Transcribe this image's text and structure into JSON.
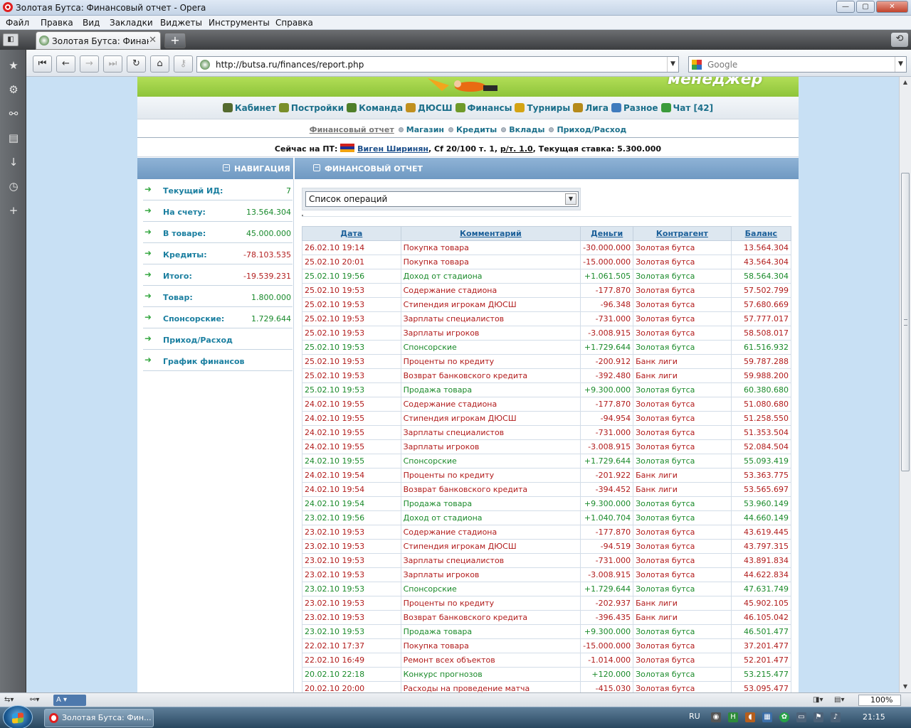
{
  "window": {
    "title": "Золотая Бутса: Финансовый отчет - Opera",
    "min": "—",
    "max": "▢",
    "close": "✕"
  },
  "menu": [
    "Файл",
    "Правка",
    "Вид",
    "Закладки",
    "Виджеты",
    "Инструменты",
    "Справка"
  ],
  "tab": {
    "title": "Золотая Бутса: Финан...",
    "close": "✕",
    "new": "+"
  },
  "address": {
    "url": "http://butsa.ru/finances/report.php",
    "search_placeholder": "Google"
  },
  "site": {
    "logo": "менеджер",
    "nav": [
      {
        "label": "Кабинет",
        "icon": "pencil-icon",
        "color": "#556b2f"
      },
      {
        "label": "Постройки",
        "icon": "buildings-icon",
        "color": "#7a8f2a"
      },
      {
        "label": "Команда",
        "icon": "player-icon",
        "color": "#4f7f2a"
      },
      {
        "label": "ДЮСШ",
        "icon": "kid-icon",
        "color": "#c09020"
      },
      {
        "label": "Финансы",
        "icon": "money-icon",
        "color": "#6f9a2a"
      },
      {
        "label": "Турниры",
        "icon": "trophy-icon",
        "color": "#d4a414"
      },
      {
        "label": "Лига",
        "icon": "league-icon",
        "color": "#b58a1a"
      },
      {
        "label": "Разное",
        "icon": "chart-icon",
        "color": "#3f7bbd"
      },
      {
        "label": "Чат [42]",
        "icon": "chat-icon",
        "color": "#3b9b3b"
      }
    ],
    "subnav": [
      "Финансовый отчет",
      "Магазин",
      "Кредиты",
      "Вклады",
      "Приход/Расход"
    ],
    "status": {
      "prefix": "Сейчас на ПТ:",
      "user": "Виген Ширинян",
      "mid1": ", Cf 20/100 т. 1,",
      "rate_link": "р/т. 1.0",
      "suffix": ", Текущая ставка: 5.300.000"
    },
    "nav_header": "НАВИГАЦИЯ",
    "report_header": "ФИНАНСОВЫЙ ОТЧЕТ",
    "left_items": [
      {
        "label": "Текущий ИД:",
        "value": "7",
        "tone": "g"
      },
      {
        "label": "На счету:",
        "value": "13.564.304",
        "tone": "g"
      },
      {
        "label": "В товаре:",
        "value": "45.000.000",
        "tone": "g"
      },
      {
        "label": "Кредиты:",
        "value": "-78.103.535",
        "tone": "r"
      },
      {
        "label": "Итого:",
        "value": "-19.539.231",
        "tone": "r"
      },
      {
        "label": "Товар:",
        "value": "1.800.000",
        "tone": "g"
      },
      {
        "label": "Спонсорские:",
        "value": "1.729.644",
        "tone": "g"
      },
      {
        "label": "Приход/Расход",
        "value": "",
        "tone": "g"
      },
      {
        "label": "График финансов",
        "value": "",
        "tone": "g"
      }
    ],
    "select_value": "Список операций",
    "columns": [
      "Дата",
      "Комментарий",
      "Деньги",
      "Контрагент",
      "Баланс"
    ],
    "rows": [
      [
        "26.02.10 19:14",
        "Покупка товара",
        "-30.000.000",
        "Золотая бутса",
        "13.564.304",
        "r"
      ],
      [
        "25.02.10 20:01",
        "Покупка товара",
        "-15.000.000",
        "Золотая бутса",
        "43.564.304",
        "r"
      ],
      [
        "25.02.10 19:56",
        "Доход от стадиона",
        "+1.061.505",
        "Золотая бутса",
        "58.564.304",
        "g"
      ],
      [
        "25.02.10 19:53",
        "Содержание стадиона",
        "-177.870",
        "Золотая бутса",
        "57.502.799",
        "r"
      ],
      [
        "25.02.10 19:53",
        "Стипендия игрокам ДЮСШ",
        "-96.348",
        "Золотая бутса",
        "57.680.669",
        "r"
      ],
      [
        "25.02.10 19:53",
        "Зарплаты специалистов",
        "-731.000",
        "Золотая бутса",
        "57.777.017",
        "r"
      ],
      [
        "25.02.10 19:53",
        "Зарплаты игроков",
        "-3.008.915",
        "Золотая бутса",
        "58.508.017",
        "r"
      ],
      [
        "25.02.10 19:53",
        "Спонсорские",
        "+1.729.644",
        "Золотая бутса",
        "61.516.932",
        "g"
      ],
      [
        "25.02.10 19:53",
        "Проценты по кредиту",
        "-200.912",
        "Банк лиги",
        "59.787.288",
        "r"
      ],
      [
        "25.02.10 19:53",
        "Возврат банковского кредита",
        "-392.480",
        "Банк лиги",
        "59.988.200",
        "r"
      ],
      [
        "25.02.10 19:53",
        "Продажа товара",
        "+9.300.000",
        "Золотая бутса",
        "60.380.680",
        "g"
      ],
      [
        "24.02.10 19:55",
        "Содержание стадиона",
        "-177.870",
        "Золотая бутса",
        "51.080.680",
        "r"
      ],
      [
        "24.02.10 19:55",
        "Стипендия игрокам ДЮСШ",
        "-94.954",
        "Золотая бутса",
        "51.258.550",
        "r"
      ],
      [
        "24.02.10 19:55",
        "Зарплаты специалистов",
        "-731.000",
        "Золотая бутса",
        "51.353.504",
        "r"
      ],
      [
        "24.02.10 19:55",
        "Зарплаты игроков",
        "-3.008.915",
        "Золотая бутса",
        "52.084.504",
        "r"
      ],
      [
        "24.02.10 19:55",
        "Спонсорские",
        "+1.729.644",
        "Золотая бутса",
        "55.093.419",
        "g"
      ],
      [
        "24.02.10 19:54",
        "Проценты по кредиту",
        "-201.922",
        "Банк лиги",
        "53.363.775",
        "r"
      ],
      [
        "24.02.10 19:54",
        "Возврат банковского кредита",
        "-394.452",
        "Банк лиги",
        "53.565.697",
        "r"
      ],
      [
        "24.02.10 19:54",
        "Продажа товара",
        "+9.300.000",
        "Золотая бутса",
        "53.960.149",
        "g"
      ],
      [
        "23.02.10 19:56",
        "Доход от стадиона",
        "+1.040.704",
        "Золотая бутса",
        "44.660.149",
        "g"
      ],
      [
        "23.02.10 19:53",
        "Содержание стадиона",
        "-177.870",
        "Золотая бутса",
        "43.619.445",
        "r"
      ],
      [
        "23.02.10 19:53",
        "Стипендия игрокам ДЮСШ",
        "-94.519",
        "Золотая бутса",
        "43.797.315",
        "r"
      ],
      [
        "23.02.10 19:53",
        "Зарплаты специалистов",
        "-731.000",
        "Золотая бутса",
        "43.891.834",
        "r"
      ],
      [
        "23.02.10 19:53",
        "Зарплаты игроков",
        "-3.008.915",
        "Золотая бутса",
        "44.622.834",
        "r"
      ],
      [
        "23.02.10 19:53",
        "Спонсорские",
        "+1.729.644",
        "Золотая бутса",
        "47.631.749",
        "g"
      ],
      [
        "23.02.10 19:53",
        "Проценты по кредиту",
        "-202.937",
        "Банк лиги",
        "45.902.105",
        "r"
      ],
      [
        "23.02.10 19:53",
        "Возврат банковского кредита",
        "-396.435",
        "Банк лиги",
        "46.105.042",
        "r"
      ],
      [
        "23.02.10 19:53",
        "Продажа товара",
        "+9.300.000",
        "Золотая бутса",
        "46.501.477",
        "g"
      ],
      [
        "22.02.10 17:37",
        "Покупка товара",
        "-15.000.000",
        "Золотая бутса",
        "37.201.477",
        "r"
      ],
      [
        "22.02.10 16:49",
        "Ремонт всех объектов",
        "-1.014.000",
        "Золотая бутса",
        "52.201.477",
        "r"
      ],
      [
        "20.02.10 22:18",
        "Конкурс прогнозов",
        "+120.000",
        "Золотая бутса",
        "53.215.477",
        "g"
      ],
      [
        "20.02.10 20:00",
        "Расходы на проведение матча",
        "-415.030",
        "Золотая бутса",
        "53.095.477",
        "r"
      ]
    ]
  },
  "statusbar": {
    "zoom": "100%",
    "view_label": "A"
  },
  "taskbar": {
    "task_title": "Золотая Бутса: Фин...",
    "lang": "RU",
    "clock": "21:15"
  },
  "colors": {
    "green_text": "#1a8a2a",
    "red_text": "#b11b1b",
    "link": "#1b6f8a",
    "header_blue": "#7fa6cc"
  }
}
